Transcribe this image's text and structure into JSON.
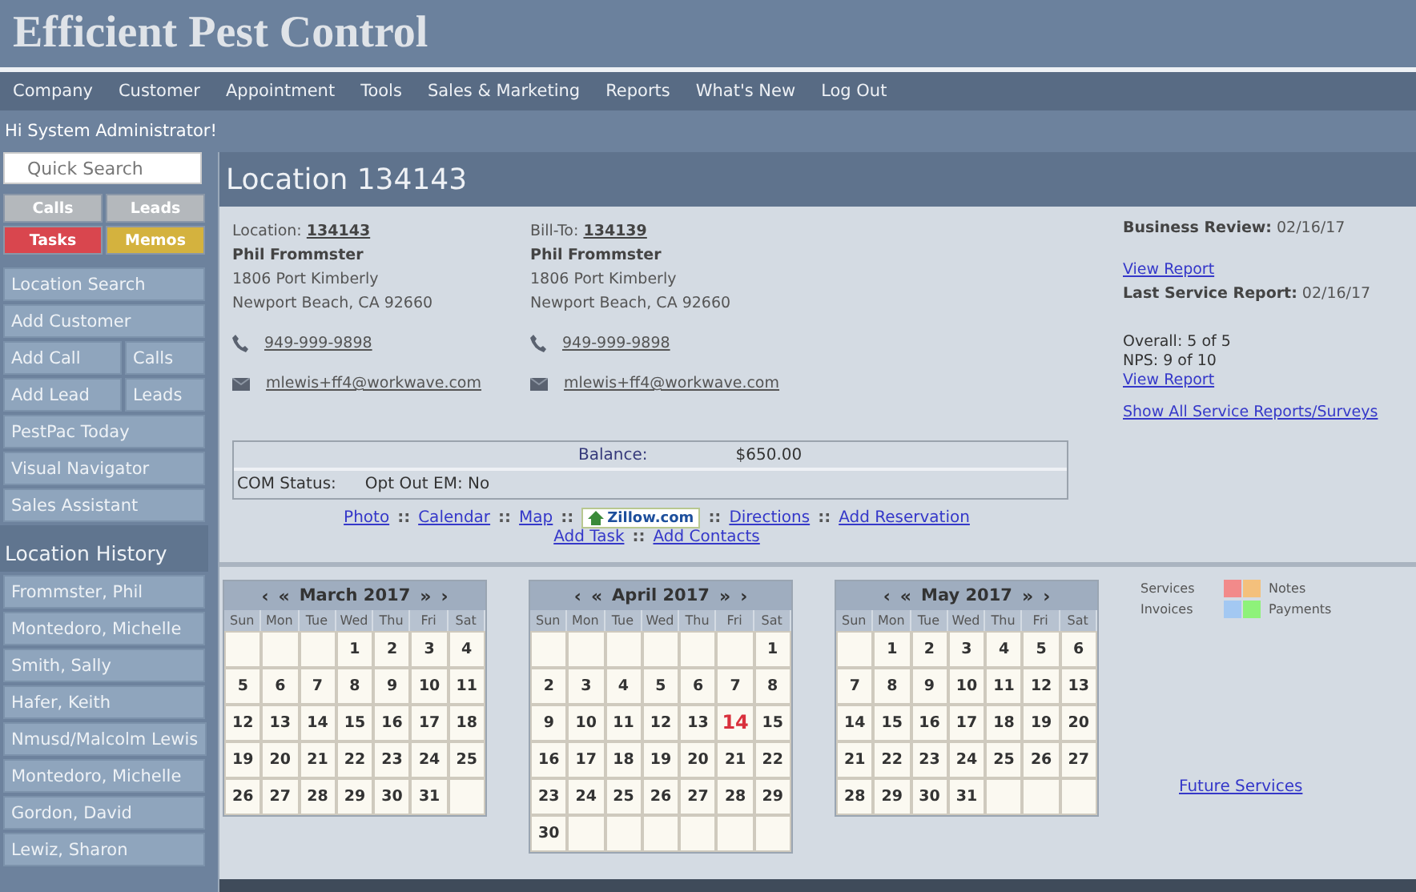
{
  "app_title": "Efficient Pest Control",
  "menu": [
    "Company",
    "Customer",
    "Appointment",
    "Tools",
    "Sales & Marketing",
    "Reports",
    "What's New",
    "Log Out"
  ],
  "greeting": "Hi System Administrator!",
  "search": {
    "placeholder": "Quick Search"
  },
  "quick_buttons": [
    {
      "label": "Calls",
      "color": "#b4b8bc"
    },
    {
      "label": "Leads",
      "color": "#b4b8bc"
    },
    {
      "label": "Tasks",
      "color": "#d9464e"
    },
    {
      "label": "Memos",
      "color": "#d4b23e"
    }
  ],
  "nav": [
    {
      "kind": "single",
      "labels": [
        "Location Search"
      ]
    },
    {
      "kind": "single",
      "labels": [
        "Add Customer"
      ]
    },
    {
      "kind": "pair",
      "labels": [
        "Add Call",
        "Calls"
      ]
    },
    {
      "kind": "pair",
      "labels": [
        "Add Lead",
        "Leads"
      ]
    },
    {
      "kind": "single",
      "labels": [
        "PestPac Today"
      ]
    },
    {
      "kind": "single",
      "labels": [
        "Visual Navigator"
      ]
    },
    {
      "kind": "single",
      "labels": [
        "Sales Assistant"
      ]
    }
  ],
  "history_title": "Location History",
  "history": [
    "Frommster, Phil",
    "Montedoro, Michelle",
    "Smith, Sally",
    "Hafer, Keith",
    "Nmusd/Malcolm Lewis",
    "Montedoro, Michelle",
    "Gordon, David",
    "Lewiz, Sharon"
  ],
  "page_title": "Location 134143",
  "contacts": [
    {
      "label": "Location:",
      "number": "134143",
      "name": "Phil Frommster",
      "address": [
        "1806 Port Kimberly",
        "Newport Beach, CA 92660"
      ],
      "phone": "949-999-9898",
      "email": "mlewis+ff4@workwave.com"
    },
    {
      "label": "Bill-To:",
      "number": "134139",
      "name": "Phil Frommster",
      "address": [
        "1806 Port Kimberly",
        "Newport Beach, CA 92660"
      ],
      "phone": "949-999-9898",
      "email": "mlewis+ff4@workwave.com"
    }
  ],
  "reviews": {
    "business_label": "Business Review:",
    "business_date": "02/16/17",
    "view_report": "View Report",
    "last_label": "Last Service Report:",
    "last_date": "02/16/17",
    "scores": [
      "Overall: 5 of 5",
      "NPS: 9 of 10"
    ],
    "view_report_2": "View Report",
    "show_all": "Show All Service Reports/Surveys"
  },
  "balance": {
    "label": "Balance:",
    "value": "$650.00",
    "com_status": "COM Status:",
    "opt_out": "Opt Out EM: No"
  },
  "links_row1": [
    "Photo",
    "Calendar",
    "Map"
  ],
  "zillow": "Zillow.com",
  "links_row1b": [
    "Directions",
    "Add Reservation"
  ],
  "links_row2": [
    "Add Task",
    "Add Contacts"
  ],
  "separator": "::",
  "calendar_nav": {
    "prev": "‹",
    "prev_year": "«",
    "next_year": "»",
    "next": "›"
  },
  "months": [
    {
      "title": "March 2017",
      "weekdays": [
        "Sun",
        "Mon",
        "Tue",
        "Wed",
        "Thu",
        "Fri",
        "Sat"
      ],
      "weeks": [
        [
          {
            "kind": "blank"
          },
          {
            "kind": "blank"
          },
          {
            "kind": "blank"
          },
          {
            "kind": "day",
            "day": "1",
            "today": false
          },
          {
            "kind": "day",
            "day": "2",
            "today": false
          },
          {
            "kind": "day",
            "day": "3",
            "today": false
          },
          {
            "kind": "day",
            "day": "4",
            "today": false
          }
        ],
        [
          {
            "kind": "day",
            "day": "5",
            "today": false
          },
          {
            "kind": "day",
            "day": "6",
            "today": false
          },
          {
            "kind": "day",
            "day": "7",
            "today": false
          },
          {
            "kind": "day",
            "day": "8",
            "today": false
          },
          {
            "kind": "day",
            "day": "9",
            "today": false
          },
          {
            "kind": "day",
            "day": "10",
            "today": false
          },
          {
            "kind": "day",
            "day": "11",
            "today": false
          }
        ],
        [
          {
            "kind": "day",
            "day": "12",
            "today": false
          },
          {
            "kind": "day",
            "day": "13",
            "today": false
          },
          {
            "kind": "day",
            "day": "14",
            "today": false
          },
          {
            "kind": "day",
            "day": "15",
            "today": false
          },
          {
            "kind": "day",
            "day": "16",
            "today": false
          },
          {
            "kind": "day",
            "day": "17",
            "today": false
          },
          {
            "kind": "day",
            "day": "18",
            "today": false
          }
        ],
        [
          {
            "kind": "day",
            "day": "19",
            "today": false
          },
          {
            "kind": "day",
            "day": "20",
            "today": false
          },
          {
            "kind": "day",
            "day": "21",
            "today": false
          },
          {
            "kind": "day",
            "day": "22",
            "today": false
          },
          {
            "kind": "day",
            "day": "23",
            "today": false
          },
          {
            "kind": "day",
            "day": "24",
            "today": false
          },
          {
            "kind": "day",
            "day": "25",
            "today": false
          }
        ],
        [
          {
            "kind": "day",
            "day": "26",
            "today": false
          },
          {
            "kind": "day",
            "day": "27",
            "today": false
          },
          {
            "kind": "day",
            "day": "28",
            "today": false
          },
          {
            "kind": "day",
            "day": "29",
            "today": false
          },
          {
            "kind": "day",
            "day": "30",
            "today": false
          },
          {
            "kind": "day",
            "day": "31",
            "today": false
          },
          {
            "kind": "blank"
          }
        ]
      ]
    },
    {
      "title": "April 2017",
      "weekdays": [
        "Sun",
        "Mon",
        "Tue",
        "Wed",
        "Thu",
        "Fri",
        "Sat"
      ],
      "weeks": [
        [
          {
            "kind": "blank"
          },
          {
            "kind": "blank"
          },
          {
            "kind": "blank"
          },
          {
            "kind": "blank"
          },
          {
            "kind": "blank"
          },
          {
            "kind": "blank"
          },
          {
            "kind": "day",
            "day": "1",
            "today": false
          }
        ],
        [
          {
            "kind": "day",
            "day": "2",
            "today": false
          },
          {
            "kind": "day",
            "day": "3",
            "today": false
          },
          {
            "kind": "day",
            "day": "4",
            "today": false
          },
          {
            "kind": "day",
            "day": "5",
            "today": false
          },
          {
            "kind": "day",
            "day": "6",
            "today": false
          },
          {
            "kind": "day",
            "day": "7",
            "today": false
          },
          {
            "kind": "day",
            "day": "8",
            "today": false
          }
        ],
        [
          {
            "kind": "day",
            "day": "9",
            "today": false
          },
          {
            "kind": "day",
            "day": "10",
            "today": false
          },
          {
            "kind": "day",
            "day": "11",
            "today": false
          },
          {
            "kind": "day",
            "day": "12",
            "today": false
          },
          {
            "kind": "day",
            "day": "13",
            "today": false
          },
          {
            "kind": "day",
            "day": "14",
            "today": true
          },
          {
            "kind": "day",
            "day": "15",
            "today": false
          }
        ],
        [
          {
            "kind": "day",
            "day": "16",
            "today": false
          },
          {
            "kind": "day",
            "day": "17",
            "today": false
          },
          {
            "kind": "day",
            "day": "18",
            "today": false
          },
          {
            "kind": "day",
            "day": "19",
            "today": false
          },
          {
            "kind": "day",
            "day": "20",
            "today": false
          },
          {
            "kind": "day",
            "day": "21",
            "today": false
          },
          {
            "kind": "day",
            "day": "22",
            "today": false
          }
        ],
        [
          {
            "kind": "day",
            "day": "23",
            "today": false
          },
          {
            "kind": "day",
            "day": "24",
            "today": false
          },
          {
            "kind": "day",
            "day": "25",
            "today": false
          },
          {
            "kind": "day",
            "day": "26",
            "today": false
          },
          {
            "kind": "day",
            "day": "27",
            "today": false
          },
          {
            "kind": "day",
            "day": "28",
            "today": false
          },
          {
            "kind": "day",
            "day": "29",
            "today": false
          }
        ],
        [
          {
            "kind": "day",
            "day": "30",
            "today": false
          },
          {
            "kind": "blank"
          },
          {
            "kind": "blank"
          },
          {
            "kind": "blank"
          },
          {
            "kind": "blank"
          },
          {
            "kind": "blank"
          },
          {
            "kind": "blank"
          }
        ]
      ]
    },
    {
      "title": "May 2017",
      "weekdays": [
        "Sun",
        "Mon",
        "Tue",
        "Wed",
        "Thu",
        "Fri",
        "Sat"
      ],
      "weeks": [
        [
          {
            "kind": "blank"
          },
          {
            "kind": "day",
            "day": "1",
            "today": false
          },
          {
            "kind": "day",
            "day": "2",
            "today": false
          },
          {
            "kind": "day",
            "day": "3",
            "today": false
          },
          {
            "kind": "day",
            "day": "4",
            "today": false
          },
          {
            "kind": "day",
            "day": "5",
            "today": false
          },
          {
            "kind": "day",
            "day": "6",
            "today": false
          }
        ],
        [
          {
            "kind": "day",
            "day": "7",
            "today": false
          },
          {
            "kind": "day",
            "day": "8",
            "today": false
          },
          {
            "kind": "day",
            "day": "9",
            "today": false
          },
          {
            "kind": "day",
            "day": "10",
            "today": false
          },
          {
            "kind": "day",
            "day": "11",
            "today": false
          },
          {
            "kind": "day",
            "day": "12",
            "today": false
          },
          {
            "kind": "day",
            "day": "13",
            "today": false
          }
        ],
        [
          {
            "kind": "day",
            "day": "14",
            "today": false
          },
          {
            "kind": "day",
            "day": "15",
            "today": false
          },
          {
            "kind": "day",
            "day": "16",
            "today": false
          },
          {
            "kind": "day",
            "day": "17",
            "today": false
          },
          {
            "kind": "day",
            "day": "18",
            "today": false
          },
          {
            "kind": "day",
            "day": "19",
            "today": false
          },
          {
            "kind": "day",
            "day": "20",
            "today": false
          }
        ],
        [
          {
            "kind": "day",
            "day": "21",
            "today": false
          },
          {
            "kind": "day",
            "day": "22",
            "today": false
          },
          {
            "kind": "day",
            "day": "23",
            "today": false
          },
          {
            "kind": "day",
            "day": "24",
            "today": false
          },
          {
            "kind": "day",
            "day": "25",
            "today": false
          },
          {
            "kind": "day",
            "day": "26",
            "today": false
          },
          {
            "kind": "day",
            "day": "27",
            "today": false
          }
        ],
        [
          {
            "kind": "day",
            "day": "28",
            "today": false
          },
          {
            "kind": "day",
            "day": "29",
            "today": false
          },
          {
            "kind": "day",
            "day": "30",
            "today": false
          },
          {
            "kind": "day",
            "day": "31",
            "today": false
          },
          {
            "kind": "blank"
          },
          {
            "kind": "blank"
          },
          {
            "kind": "blank"
          }
        ]
      ]
    }
  ],
  "legend": [
    {
      "label": "Services",
      "color": "#f28a8a"
    },
    {
      "label": "Notes",
      "color": "#f4c07c"
    },
    {
      "label": "Invoices",
      "color": "#a3c8f2"
    },
    {
      "label": "Payments",
      "color": "#8ef27a"
    }
  ],
  "future_services": "Future Services"
}
